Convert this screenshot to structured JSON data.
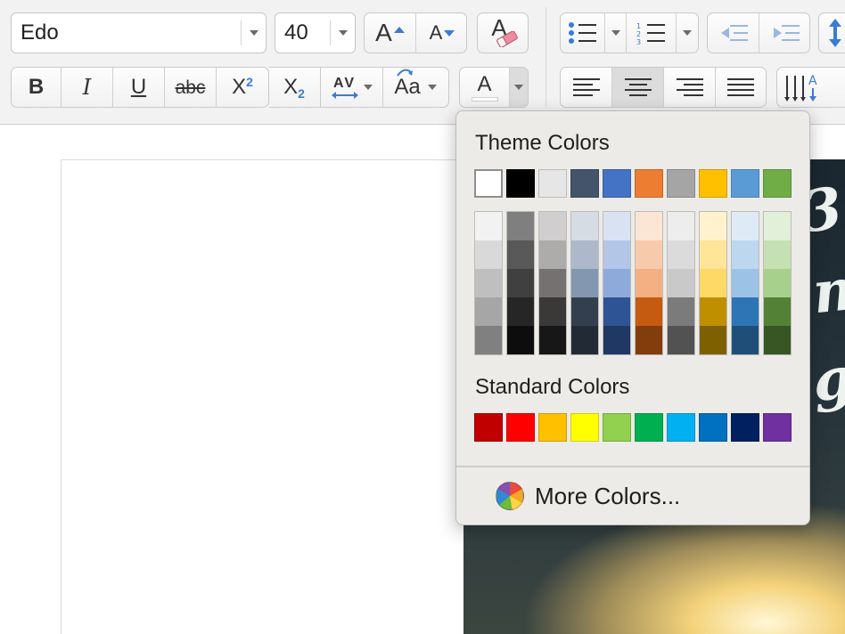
{
  "ribbon": {
    "font_name": "Edo",
    "font_size": "40",
    "bold": "B",
    "italic": "I",
    "underline": "U",
    "strikethrough": "abc",
    "superscript": "X",
    "superscript_mark": "2",
    "subscript": "X",
    "subscript_mark": "2",
    "char_spacing": "AV",
    "change_case": "Aa",
    "font_color_letter": "A",
    "grow_letter": "A",
    "shrink_letter": "A",
    "clear_letter": "A",
    "sort_letter": "A"
  },
  "color_picker": {
    "theme_heading": "Theme Colors",
    "standard_heading": "Standard Colors",
    "more_colors": "More Colors...",
    "theme_base": [
      "#ffffff",
      "#000000",
      "#e7e6e6",
      "#44546a",
      "#4472c4",
      "#ed7d31",
      "#a5a5a5",
      "#ffc000",
      "#5b9bd5",
      "#70ad47"
    ],
    "theme_shades": [
      [
        "#f2f2f2",
        "#d9d9d9",
        "#bfbfbf",
        "#a6a6a6",
        "#808080"
      ],
      [
        "#7f7f7f",
        "#595959",
        "#404040",
        "#262626",
        "#0d0d0d"
      ],
      [
        "#d0cece",
        "#aeabab",
        "#767171",
        "#3b3838",
        "#181717"
      ],
      [
        "#d6dce4",
        "#adb9ca",
        "#8497b0",
        "#333f4f",
        "#222a35"
      ],
      [
        "#d9e2f3",
        "#b4c6e7",
        "#8eaadb",
        "#2f5496",
        "#1f3864"
      ],
      [
        "#fbe5d5",
        "#f7caac",
        "#f4b083",
        "#c55a11",
        "#833c0b"
      ],
      [
        "#ededed",
        "#dbdbdb",
        "#c9c9c9",
        "#7b7b7b",
        "#525252"
      ],
      [
        "#fff2cc",
        "#ffe599",
        "#ffd966",
        "#bf8f00",
        "#7f6000"
      ],
      [
        "#deebf6",
        "#bdd7ee",
        "#9cc3e5",
        "#2e75b5",
        "#1f4e79"
      ],
      [
        "#e2efd9",
        "#c5e0b3",
        "#a8d08d",
        "#538135",
        "#375623"
      ]
    ],
    "standard": [
      "#c00000",
      "#ff0000",
      "#ffc000",
      "#ffff00",
      "#92d050",
      "#00b050",
      "#00b0f0",
      "#0070c0",
      "#002060",
      "#7030a0"
    ],
    "selected": "#ffffff"
  }
}
